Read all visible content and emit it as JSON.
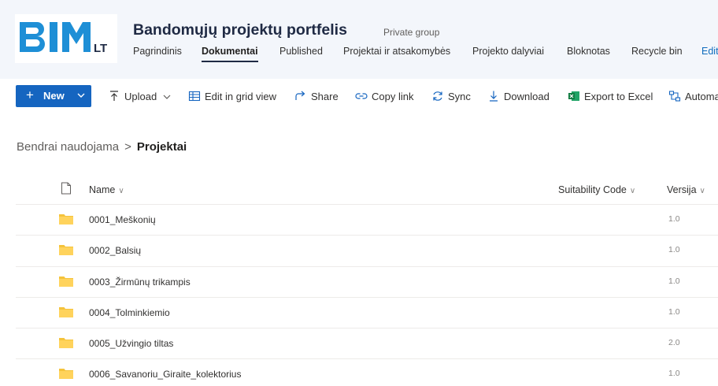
{
  "header": {
    "logo_text": "BIM LT",
    "title": "Bandomųjų projektų portfelis",
    "privacy": "Private group",
    "nav": [
      {
        "label": "Pagrindinis",
        "active": false
      },
      {
        "label": "Dokumentai",
        "active": true
      },
      {
        "label": "Published",
        "active": false
      },
      {
        "label": "Projektai ir atsakomybės",
        "active": false
      },
      {
        "label": "Projekto dalyviai",
        "active": false
      },
      {
        "label": "Bloknotas",
        "active": false
      },
      {
        "label": "Recycle bin",
        "active": false
      },
      {
        "label": "Edit",
        "active": false
      }
    ]
  },
  "commandbar": {
    "new_label": "New",
    "commands": [
      {
        "label": "Upload",
        "icon": "upload-icon"
      },
      {
        "label": "Edit in grid view",
        "icon": "grid-icon"
      },
      {
        "label": "Share",
        "icon": "share-icon"
      },
      {
        "label": "Copy link",
        "icon": "link-icon"
      },
      {
        "label": "Sync",
        "icon": "sync-icon"
      },
      {
        "label": "Download",
        "icon": "download-icon"
      },
      {
        "label": "Export to Excel",
        "icon": "excel-icon"
      },
      {
        "label": "Automa",
        "icon": "automate-icon"
      }
    ]
  },
  "breadcrumb": {
    "parent": "Bendrai naudojama",
    "separator": ">",
    "current": "Projektai"
  },
  "list": {
    "columns": {
      "name": "Name",
      "suitability": "Suitability Code",
      "version": "Versija"
    },
    "rows": [
      {
        "name": "0001_Meškonių",
        "version": "1.0"
      },
      {
        "name": "0002_Balsių",
        "version": "1.0"
      },
      {
        "name": "0003_Žirmūnų trikampis",
        "version": "1.0"
      },
      {
        "name": "0004_Tolminkiemio",
        "version": "1.0"
      },
      {
        "name": "0005_Užvingio tiltas",
        "version": "2.0"
      },
      {
        "name": "0006_Savanoriu_Giraite_kolektorius",
        "version": "1.0"
      }
    ]
  },
  "colors": {
    "accent": "#1565c0",
    "header_bg": "#f3f6fb",
    "logo_blue": "#1e8fd6",
    "folder": "#f5c33b"
  }
}
